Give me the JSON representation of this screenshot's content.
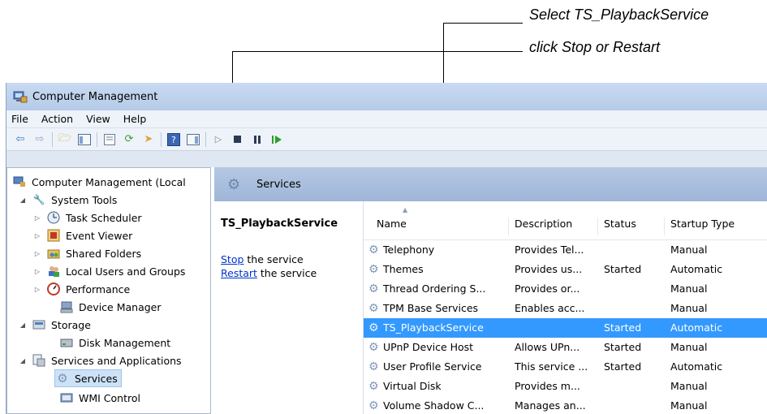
{
  "callouts": {
    "select": "Select TS_PlaybackService",
    "stop": "click Stop or Restart"
  },
  "window": {
    "title": "Computer Management",
    "menu": [
      "File",
      "Action",
      "View",
      "Help"
    ]
  },
  "tree": {
    "root": "Computer Management (Local",
    "items": [
      {
        "label": "System Tools",
        "icon": "tools-icon"
      },
      {
        "label": "Task Scheduler",
        "icon": "clock-icon"
      },
      {
        "label": "Event Viewer",
        "icon": "event-viewer-icon"
      },
      {
        "label": "Shared Folders",
        "icon": "shared-folder-icon"
      },
      {
        "label": "Local Users and Groups",
        "icon": "users-icon"
      },
      {
        "label": "Performance",
        "icon": "performance-icon"
      },
      {
        "label": "Device Manager",
        "icon": "device-manager-icon"
      },
      {
        "label": "Storage",
        "icon": "storage-icon"
      },
      {
        "label": "Disk Management",
        "icon": "disk-icon"
      },
      {
        "label": "Services and Applications",
        "icon": "services-apps-icon"
      },
      {
        "label": "Services",
        "icon": "gear-icon"
      },
      {
        "label": "WMI Control",
        "icon": "wmi-icon"
      }
    ]
  },
  "services_header": "Services",
  "details": {
    "title": "TS_PlaybackService",
    "stop_link": "Stop",
    "stop_suffix": " the service",
    "restart_link": "Restart",
    "restart_suffix": " the service"
  },
  "list": {
    "columns": [
      "Name",
      "Description",
      "Status",
      "Startup Type"
    ],
    "rows": [
      {
        "name": "Telephony",
        "description": "Provides Tel...",
        "status": "",
        "startup": "Manual"
      },
      {
        "name": "Themes",
        "description": "Provides us...",
        "status": "Started",
        "startup": "Automatic"
      },
      {
        "name": "Thread Ordering S...",
        "description": "Provides or...",
        "status": "",
        "startup": "Manual"
      },
      {
        "name": "TPM Base Services",
        "description": "Enables acc...",
        "status": "",
        "startup": "Manual"
      },
      {
        "name": "TS_PlaybackService",
        "description": "",
        "status": "Started",
        "startup": "Automatic"
      },
      {
        "name": "UPnP Device Host",
        "description": "Allows UPn...",
        "status": "Started",
        "startup": "Manual"
      },
      {
        "name": "User Profile Service",
        "description": "This service ...",
        "status": "Started",
        "startup": "Automatic"
      },
      {
        "name": "Virtual Disk",
        "description": "Provides m...",
        "status": "",
        "startup": "Manual"
      },
      {
        "name": "Volume Shadow C...",
        "description": "Manages an...",
        "status": "",
        "startup": "Manual"
      }
    ],
    "selected_index": 4
  },
  "colors": {
    "selection": "#3399ff",
    "link": "#0033cc",
    "header_band": "#b5c8e3"
  }
}
